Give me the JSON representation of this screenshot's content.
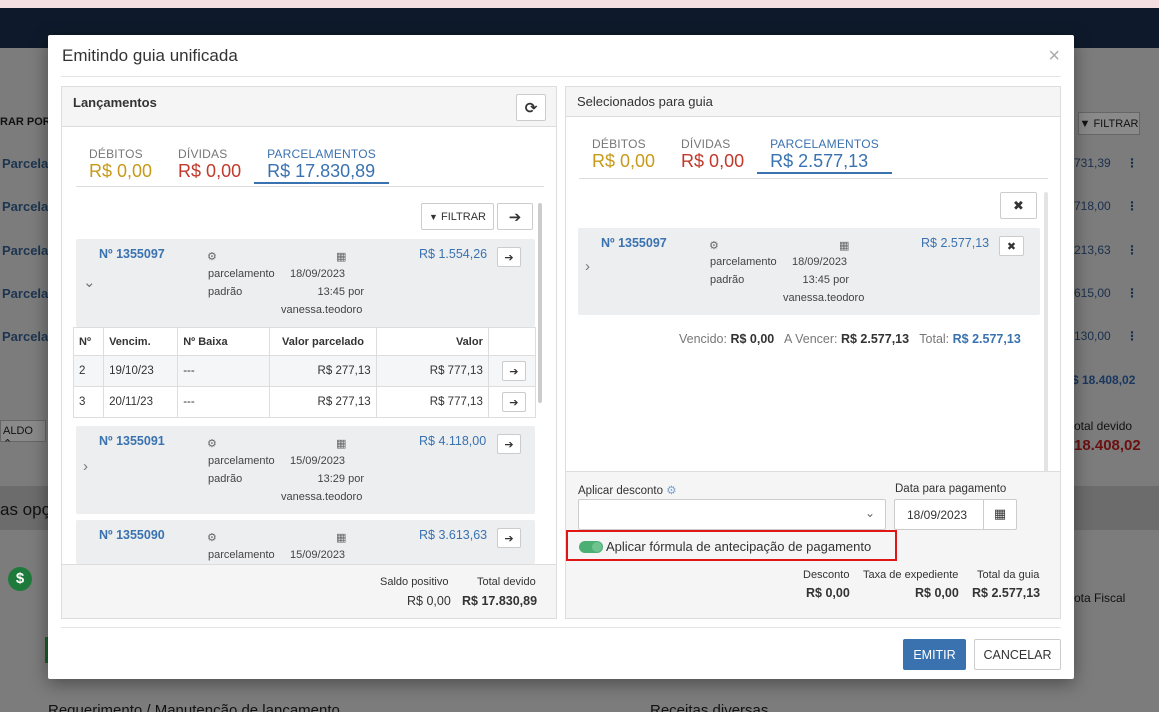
{
  "modal": {
    "title": "Emitindo guia unificada",
    "close": "×"
  },
  "background": {
    "filtrar_por": "RAR POR",
    "filtrar_btn": "FILTRAR",
    "rows": [
      {
        "label": "Parcela",
        "value": "731,39"
      },
      {
        "label": "Parcela",
        "value": "718,00"
      },
      {
        "label": "Parcela",
        "value": "213,63"
      },
      {
        "label": "Parcela",
        "value": "615,00"
      },
      {
        "label": "Parcela",
        "value": "130,00"
      }
    ],
    "total_row": "$ 18.408,02",
    "saldo": "ALDO",
    "total_devido_label": "otal devido",
    "total_devido_value": "18.408,02",
    "opcoes": "as opç",
    "nota_fiscal": "ota Fiscal",
    "bottom_left": "Requerimento / Manutenção de lançamento",
    "bottom_right": "Receitas diversas"
  },
  "left": {
    "title": "Lançamentos",
    "tabs": [
      {
        "label": "DÉBITOS",
        "value": "R$ 0,00"
      },
      {
        "label": "DÍVIDAS",
        "value": "R$ 0,00"
      },
      {
        "label": "PARCELAMENTOS",
        "value": "R$ 17.830,89"
      }
    ],
    "filter_label": "FILTRAR",
    "cards": [
      {
        "number": "Nº 1355097",
        "type1": "parcelamento",
        "type2": "padrão",
        "date": "18/09/2023",
        "time": "13:45 por",
        "user": "vanessa.teodoro",
        "amount": "R$ 1.554,26"
      },
      {
        "number": "Nº 1355091",
        "type1": "parcelamento",
        "type2": "padrão",
        "date": "15/09/2023",
        "time": "13:29 por",
        "user": "vanessa.teodoro",
        "amount": "R$ 4.118,00"
      },
      {
        "number": "Nº 1355090",
        "type1": "parcelamento",
        "type2": "",
        "date": "15/09/2023",
        "time": "",
        "user": "",
        "amount": "R$ 3.613,63"
      }
    ],
    "table": {
      "headers": [
        "Nº",
        "Vencim.",
        "Nº Baixa",
        "Valor parcelado",
        "Valor"
      ],
      "rows": [
        {
          "n": "2",
          "venc": "19/10/23",
          "baixa": "---",
          "parcelado": "R$ 277,13",
          "valor": "R$ 777,13"
        },
        {
          "n": "3",
          "venc": "20/11/23",
          "baixa": "---",
          "parcelado": "R$ 277,13",
          "valor": "R$ 777,13"
        }
      ]
    },
    "footer": {
      "saldo_label": "Saldo positivo",
      "saldo_value": "R$ 0,00",
      "total_label": "Total devido",
      "total_value": "R$ 17.830,89"
    }
  },
  "right": {
    "title": "Selecionados para guia",
    "tabs": [
      {
        "label": "DÉBITOS",
        "value": "R$ 0,00"
      },
      {
        "label": "DÍVIDAS",
        "value": "R$ 0,00"
      },
      {
        "label": "PARCELAMENTOS",
        "value": "R$ 2.577,13"
      }
    ],
    "card": {
      "number": "Nº 1355097",
      "type1": "parcelamento",
      "type2": "padrão",
      "date": "18/09/2023",
      "time": "13:45 por",
      "user": "vanessa.teodoro",
      "amount": "R$ 2.577,13"
    },
    "summary": {
      "vencido_label": "Vencido:",
      "vencido_value": "R$ 0,00",
      "avencer_label": "A Vencer:",
      "avencer_value": "R$ 2.577,13",
      "total_label": "Total:",
      "total_value": "R$ 2.577,13"
    },
    "desconto_label": "Aplicar desconto",
    "data_label": "Data para pagamento",
    "data_value": "18/09/2023",
    "toggle_label": "Aplicar fórmula de antecipação de pagamento",
    "footer": {
      "desconto_label": "Desconto",
      "desconto_value": "R$ 0,00",
      "taxa_label": "Taxa de expediente",
      "taxa_value": "R$ 0,00",
      "total_label": "Total da guia",
      "total_value": "R$ 2.577,13"
    }
  },
  "buttons": {
    "emitir": "EMITIR",
    "cancelar": "CANCELAR"
  },
  "colors": {
    "primary": "#3a72b0",
    "debitos": "#c79a1a",
    "dividas": "#c0392b",
    "total_guia": "#2ea34f",
    "highlight": "#e01515"
  }
}
